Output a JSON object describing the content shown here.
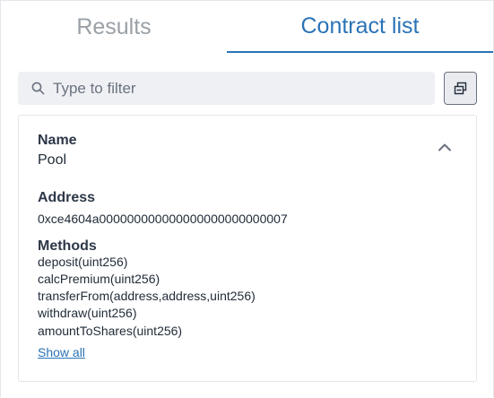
{
  "tabs": {
    "results_label": "Results",
    "contracts_label": "Contract list",
    "active": "Contract list"
  },
  "filter": {
    "placeholder": "Type to filter",
    "value": ""
  },
  "contract": {
    "name_label": "Name",
    "name": "Pool",
    "address_label": "Address",
    "address": "0xce4604a000000000000000000000000007",
    "methods_label": "Methods",
    "methods": [
      "deposit(uint256)",
      "calcPremium(uint256)",
      "transferFrom(address,address,uint256)",
      "withdraw(uint256)",
      "amountToShares(uint256)"
    ],
    "show_all_label": "Show all"
  },
  "icons": {
    "search": "search-icon",
    "collapse_all": "collapse-all-icon",
    "chevron": "chevron-up-icon"
  },
  "colors": {
    "accent": "#2b73b6",
    "inactive_tab": "#9aa0a6",
    "input_bg": "#eef0f3"
  }
}
